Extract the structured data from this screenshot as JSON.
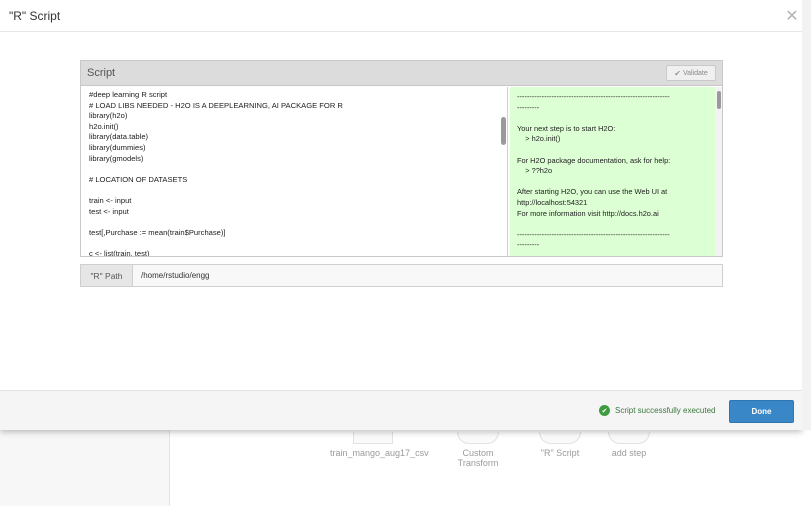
{
  "modal": {
    "title": "\"R\" Script",
    "close_icon": "close-icon"
  },
  "script_panel": {
    "title": "Script",
    "validate_label": "Validate",
    "code": "#deep learning R script\n# LOAD LIBS NEEDED - H2O IS A DEEPLEARNING, AI PACKAGE FOR R\nlibrary(h2o)\nh2o.init()\nlibrary(data.table)\nlibrary(dummies)\nlibrary(gmodels)\n\n# LOCATION OF DATASETS\n\ntrain <- input\ntest <- input\n\ntest[,Purchase := mean(train$Purchase)]\n\nc <- list(train, test)",
    "output": "--------------------------------------------------------------\n---------\n\nYour next step is to start H2O:\n    > h2o.init()\n\nFor H2O package documentation, ask for help:\n    > ??h2o\n\nAfter starting H2O, you can use the Web UI at\nhttp://localhost:54321\nFor more information visit http://docs.h2o.ai\n\n--------------------------------------------------------------\n---------",
    "output_bg": "#ddffd4"
  },
  "path": {
    "label": "\"R\" Path",
    "value": "/home/rstudio/engg"
  },
  "footer": {
    "status_text": "Script successfully executed",
    "done_label": "Done",
    "accent": "#3a87c8",
    "success_color": "#3f9b3f"
  },
  "background": {
    "nodes": [
      "train_mango_aug17_csv",
      "Custom Transform",
      "\"R\" Script",
      "add step"
    ]
  }
}
